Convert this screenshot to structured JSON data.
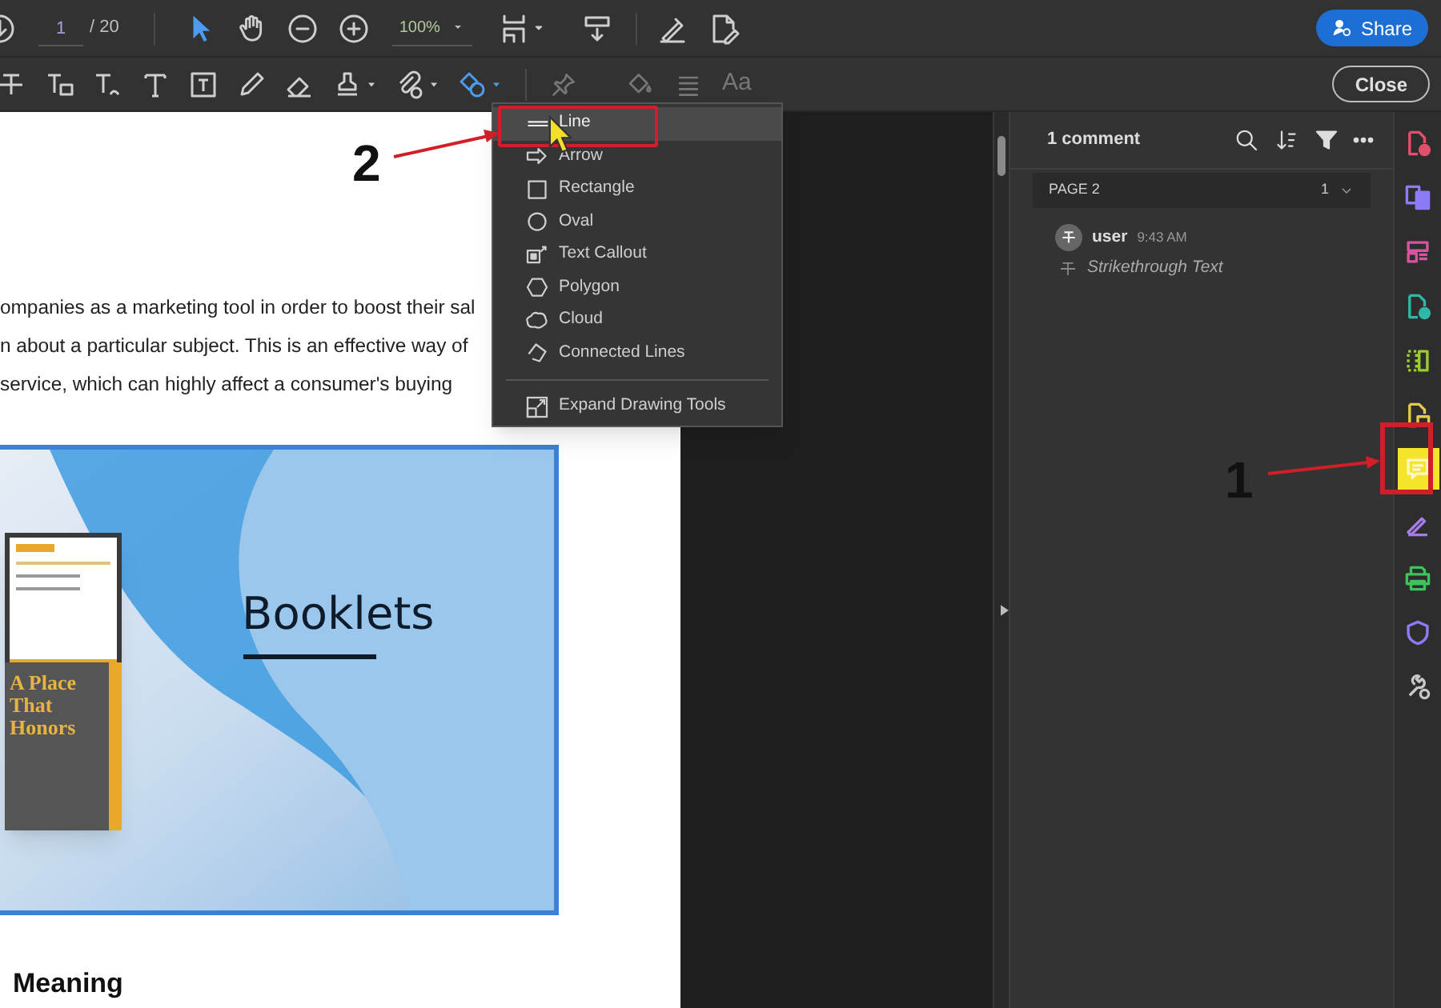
{
  "main_toolbar": {
    "page_field": "1",
    "page_total": "/ 20",
    "zoom_field": "100%",
    "tools": [
      {
        "kind": "select",
        "selected": true
      },
      {
        "kind": "hand",
        "selected": false
      }
    ],
    "share_button": "Share"
  },
  "comment_toolbar": {
    "tools": [
      {
        "kind": "strikethrough",
        "selected": false
      },
      {
        "kind": "text-comment",
        "selected": false
      },
      {
        "kind": "replace-text",
        "selected": false
      },
      {
        "kind": "add-text",
        "selected": false
      },
      {
        "kind": "text-box",
        "selected": false
      },
      {
        "kind": "pencil",
        "selected": false
      },
      {
        "kind": "eraser",
        "selected": false
      },
      {
        "kind": "stamp",
        "selected": false
      },
      {
        "kind": "attach",
        "selected": false
      },
      {
        "kind": "shapes",
        "selected": true
      }
    ],
    "font_label": "Aa",
    "close_button": "Close"
  },
  "document": {
    "paragraph_lines": [
      "ompanies as a marketing tool in order to boost their sal",
      "n about a particular subject. This is an effective way of",
      "service, which can highly affect a consumer's buying"
    ],
    "slide": {
      "title": "Booklets",
      "cover_title": "A Place That Honors"
    },
    "heading": "Meaning"
  },
  "drawing_menu": {
    "items": [
      {
        "kind": "line",
        "label": "Line",
        "selected": true
      },
      {
        "kind": "arrow",
        "label": "Arrow",
        "selected": false
      },
      {
        "kind": "rectangle",
        "label": "Rectangle",
        "selected": false
      },
      {
        "kind": "oval",
        "label": "Oval",
        "selected": false
      },
      {
        "kind": "callout",
        "label": "Text Callout",
        "selected": false
      },
      {
        "kind": "polygon",
        "label": "Polygon",
        "selected": false
      },
      {
        "kind": "cloud",
        "label": "Cloud",
        "selected": false
      },
      {
        "kind": "connected",
        "label": "Connected Lines",
        "selected": false
      }
    ],
    "expand_item": "Expand Drawing Tools"
  },
  "comments_panel": {
    "count": "1 comment",
    "page_label": "PAGE 2",
    "page_count": "1",
    "comments": [
      {
        "author": "user",
        "time": "9:43 AM",
        "type": "Strikethrough Text"
      }
    ]
  },
  "right_rail": {
    "items": [
      {
        "kind": "create",
        "color": "#e0506a",
        "selected": false
      },
      {
        "kind": "combine",
        "color": "#8b7cf6",
        "selected": false
      },
      {
        "kind": "organize",
        "color": "#d9539e",
        "selected": false
      },
      {
        "kind": "export",
        "color": "#2fb7a8",
        "selected": false
      },
      {
        "kind": "compress",
        "color": "#9acd32",
        "selected": false
      },
      {
        "kind": "request",
        "color": "#e6c84a",
        "selected": false
      },
      {
        "kind": "comment",
        "color": "#fdf6c8",
        "selected": true
      },
      {
        "kind": "sign",
        "color": "#a77ce8",
        "selected": false
      },
      {
        "kind": "print",
        "color": "#3cc45a",
        "selected": false
      },
      {
        "kind": "protect",
        "color": "#8b7cf6",
        "selected": false
      },
      {
        "kind": "tools",
        "color": "#c8c8c8",
        "selected": false
      }
    ]
  },
  "callouts": [
    {
      "label": "2"
    },
    {
      "label": "1"
    }
  ]
}
